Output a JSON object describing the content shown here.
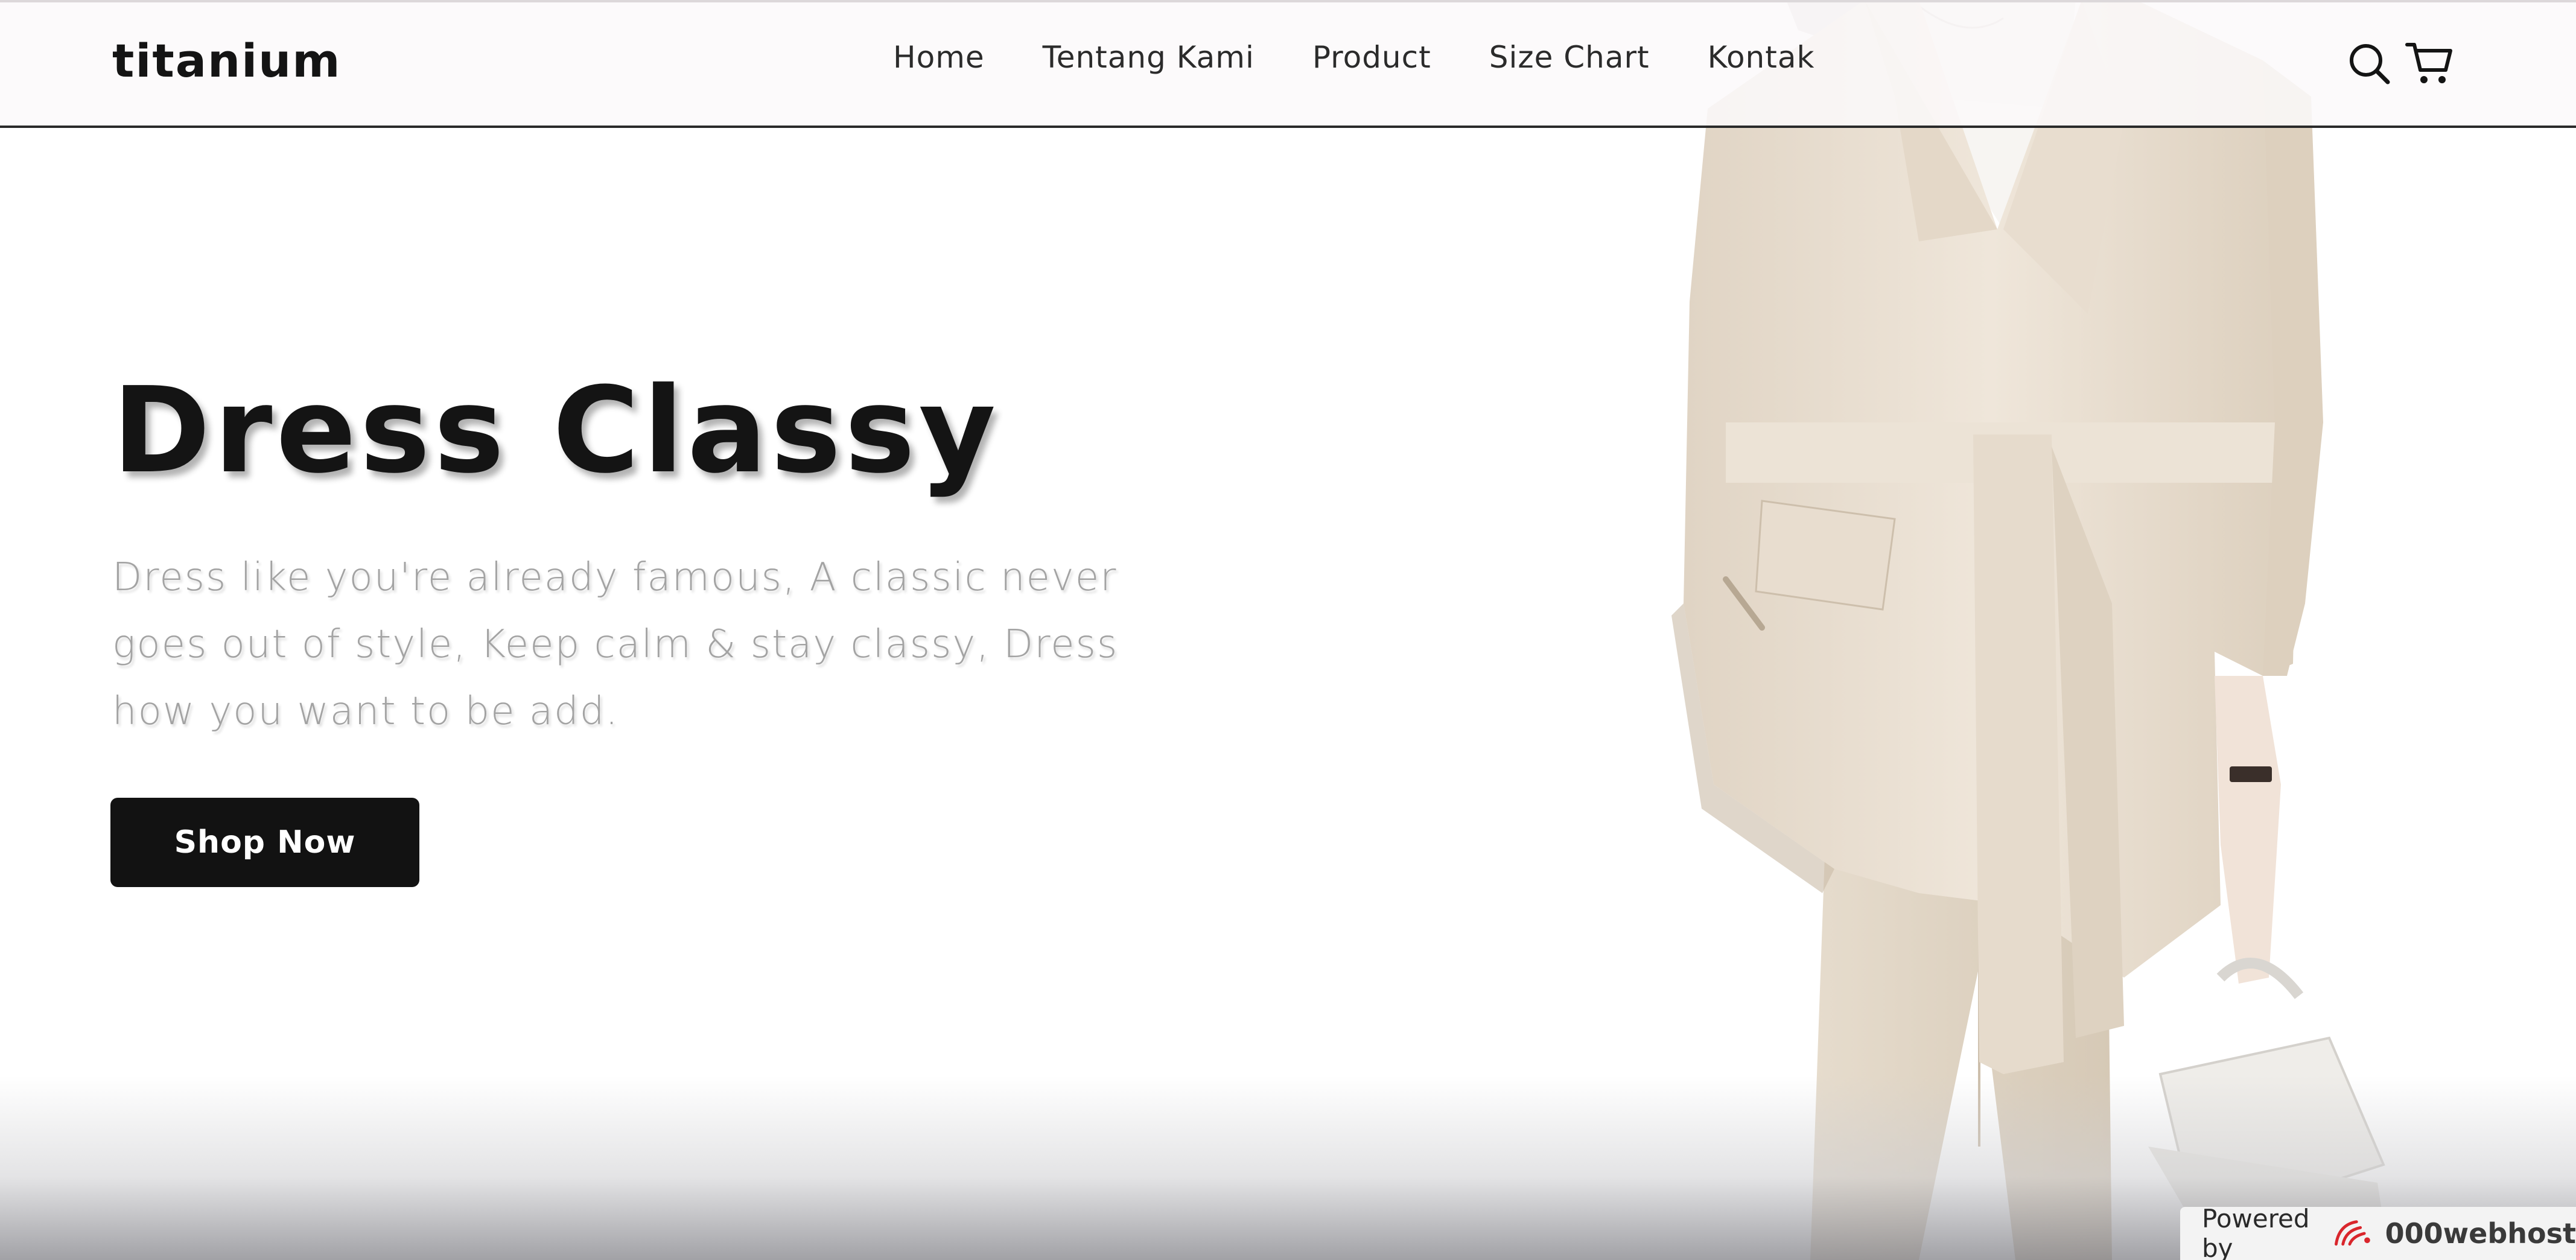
{
  "brand": {
    "name": "titanium"
  },
  "nav": {
    "items": [
      {
        "label": "Home"
      },
      {
        "label": "Tentang Kami"
      },
      {
        "label": "Product"
      },
      {
        "label": "Size Chart"
      },
      {
        "label": "Kontak"
      }
    ],
    "icons": [
      "search-icon",
      "cart-icon"
    ]
  },
  "hero": {
    "title": "Dress Classy",
    "subtitle": "Dress like you're already famous, A classic never goes out of style, Keep calm & stay classy, Dress how you want to be add.",
    "cta_label": "Shop Now"
  },
  "footer_badge": {
    "powered_label": "Powered by",
    "host_name": "000webhost",
    "logo_icon": "000webhost-logo-icon"
  },
  "colors": {
    "text": "#141414",
    "subtitle": "#a3a3a3",
    "button": "#121212",
    "suit": "#e9dfd2",
    "badge_accent": "#d9262c"
  }
}
